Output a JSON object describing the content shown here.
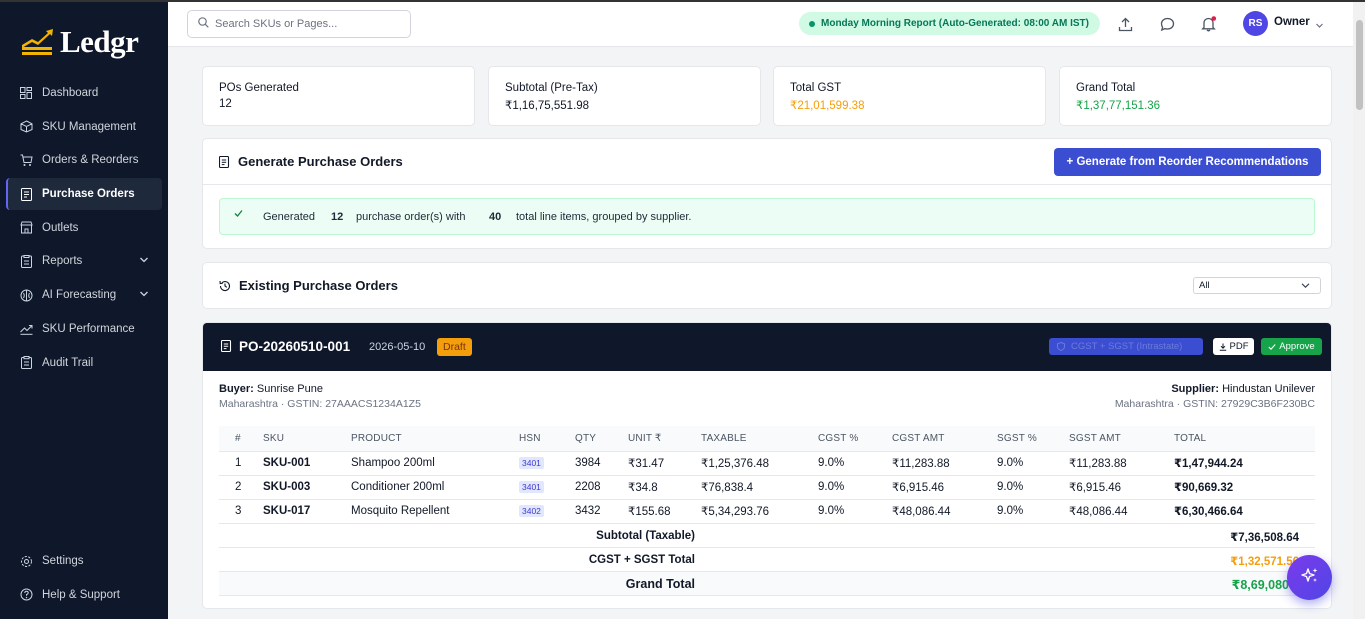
{
  "app": {
    "brand": "Ledgr"
  },
  "sidebar": {
    "items": [
      {
        "label": "Dashboard",
        "icon": "dashboard-icon"
      },
      {
        "label": "SKU Management",
        "icon": "box-icon"
      },
      {
        "label": "Orders & Reorders",
        "icon": "cart-icon"
      },
      {
        "label": "Purchase Orders",
        "icon": "document-icon",
        "active": true
      },
      {
        "label": "Outlets",
        "icon": "store-icon"
      },
      {
        "label": "Reports",
        "icon": "report-icon",
        "expandable": true
      },
      {
        "label": "AI Forecasting",
        "icon": "brain-icon",
        "expandable": true
      },
      {
        "label": "SKU Performance",
        "icon": "trend-icon"
      },
      {
        "label": "Audit Trail",
        "icon": "clipboard-icon"
      }
    ],
    "bottom": [
      {
        "label": "Settings",
        "icon": "gear-icon"
      },
      {
        "label": "Help & Support",
        "icon": "help-icon"
      }
    ]
  },
  "topbar": {
    "search_placeholder": "Search SKUs or Pages...",
    "report_status": "Monday Morning Report (Auto-Generated: 08:00 AM IST)",
    "avatar_initials": "RS",
    "user_role": "Owner"
  },
  "stats": [
    {
      "label": "POs Generated",
      "value": "12",
      "color": "#111827"
    },
    {
      "label": "Subtotal (Pre-Tax)",
      "value": "₹1,16,75,551.98",
      "color": "#111827"
    },
    {
      "label": "Total GST",
      "value": "₹21,01,599.38",
      "color": "#f59e0b"
    },
    {
      "label": "Grand Total",
      "value": "₹1,37,77,151.36",
      "color": "#16a34a"
    }
  ],
  "generate": {
    "title": "Generate Purchase Orders",
    "button": "+ Generate from Reorder Recommendations",
    "msg_pre": "Generated",
    "po_count": "12",
    "msg_mid": "purchase order(s) with",
    "line_count": "40",
    "msg_post": "total line items, grouped by supplier."
  },
  "existing": {
    "title": "Existing Purchase Orders",
    "filter_value": "All"
  },
  "po": {
    "id": "PO-20260510-001",
    "date": "2026-05-10",
    "status": "Draft",
    "gst_type": "CGST + SGST (Intrastate)",
    "pdf_label": "PDF",
    "approve_label": "Approve",
    "buyer_label": "Buyer:",
    "buyer_name": "Sunrise Pune",
    "buyer_sub": "Maharashtra · GSTIN: 27AAACS1234A1Z5",
    "supplier_label": "Supplier:",
    "supplier_name": "Hindustan Unilever",
    "supplier_sub": "Maharashtra · GSTIN: 27929C3B6F230BC",
    "columns": [
      "#",
      "SKU",
      "PRODUCT",
      "HSN",
      "QTY",
      "UNIT ₹",
      "TAXABLE",
      "CGST %",
      "CGST AMT",
      "SGST %",
      "SGST AMT",
      "TOTAL"
    ],
    "rows": [
      [
        "1",
        "SKU-001",
        "Shampoo 200ml",
        "3401",
        "3984",
        "₹31.47",
        "₹1,25,376.48",
        "9.0%",
        "₹11,283.88",
        "9.0%",
        "₹11,283.88",
        "₹1,47,944.24"
      ],
      [
        "2",
        "SKU-003",
        "Conditioner 200ml",
        "3401",
        "2208",
        "₹34.8",
        "₹76,838.4",
        "9.0%",
        "₹6,915.46",
        "9.0%",
        "₹6,915.46",
        "₹90,669.32"
      ],
      [
        "3",
        "SKU-017",
        "Mosquito Repellent",
        "3402",
        "3432",
        "₹155.68",
        "₹5,34,293.76",
        "9.0%",
        "₹48,086.44",
        "9.0%",
        "₹48,086.44",
        "₹6,30,466.64"
      ]
    ],
    "subtotal_label": "Subtotal (Taxable)",
    "subtotal_value": "₹7,36,508.64",
    "gst_total_label": "CGST + SGST Total",
    "gst_total_value": "₹1,32,571.56",
    "grand_total_label": "Grand Total",
    "grand_total_value": "₹8,69,080"
  }
}
